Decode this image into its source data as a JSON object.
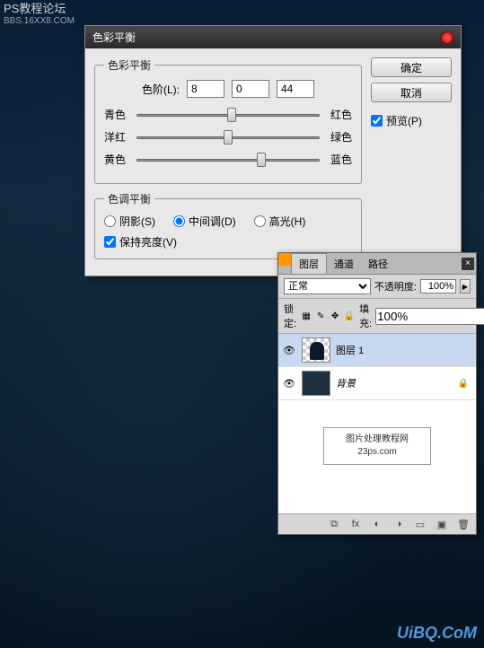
{
  "watermarks": {
    "top_left_line1": "PS教程论坛",
    "top_left_line2": "BBS.16XX8.COM",
    "bottom_right": "UiBQ.CoM",
    "box_line1": "图片处理教程网",
    "box_line2": "23ps.com"
  },
  "color_balance_dialog": {
    "title": "色彩平衡",
    "group_title": "色彩平衡",
    "levels_label": "色阶(L):",
    "levels": {
      "a": "8",
      "b": "0",
      "c": "44"
    },
    "sliders": [
      {
        "left": "青色",
        "right": "红色",
        "pos": 52
      },
      {
        "left": "洋红",
        "right": "绿色",
        "pos": 50
      },
      {
        "left": "黄色",
        "right": "蓝色",
        "pos": 68
      }
    ],
    "tone_group_title": "色调平衡",
    "tone": {
      "shadows": "阴影(S)",
      "midtones": "中间调(D)",
      "highlights": "高光(H)",
      "selected": "midtones"
    },
    "preserve_lum": "保持亮度(V)",
    "preserve_lum_checked": true,
    "buttons": {
      "ok": "确定",
      "cancel": "取消"
    },
    "preview": "预览(P)",
    "preview_checked": true
  },
  "layers_panel": {
    "tabs": {
      "layers": "图层",
      "channels": "通道",
      "paths": "路径"
    },
    "blend_mode": "正常",
    "opacity_label": "不透明度:",
    "opacity": "100%",
    "lock_label": "锁定:",
    "fill_label": "填充:",
    "fill": "100%",
    "layers": [
      {
        "name": "图层 1",
        "visible": true,
        "selected": true,
        "italic": false,
        "locked": false,
        "thumb": "checker"
      },
      {
        "name": "背景",
        "visible": true,
        "selected": false,
        "italic": true,
        "locked": true,
        "thumb": "dark"
      }
    ]
  }
}
